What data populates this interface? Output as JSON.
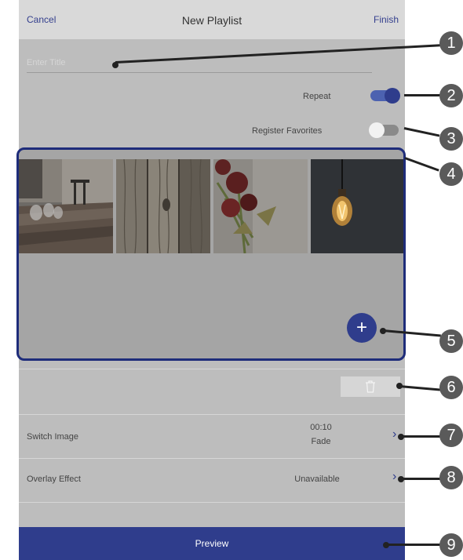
{
  "header": {
    "cancel_label": "Cancel",
    "title": "New Playlist",
    "finish_label": "Finish"
  },
  "title_input": {
    "placeholder": "Enter Title",
    "value": ""
  },
  "settings": {
    "repeat": {
      "label": "Repeat",
      "on": true
    },
    "register_favorites": {
      "label": "Register Favorites",
      "on": false
    }
  },
  "playlist": {
    "thumbnails": [
      {
        "name": "room-photo"
      },
      {
        "name": "wood-photo"
      },
      {
        "name": "dried-roses-photo"
      },
      {
        "name": "lightbulb-photo"
      }
    ],
    "add_icon": "+"
  },
  "rows": {
    "switch_image": {
      "label": "Switch Image",
      "time": "00:10",
      "effect": "Fade"
    },
    "overlay_effect": {
      "label": "Overlay Effect",
      "value": "Unavailable"
    }
  },
  "footer": {
    "preview_label": "Preview"
  },
  "callouts": [
    "1",
    "2",
    "3",
    "4",
    "5",
    "6",
    "7",
    "8",
    "9"
  ],
  "colors": {
    "accent": "#2f3d8c",
    "background": "#bdbdbd",
    "header": "#d9d9d9",
    "callout_badge": "#5a5a5a"
  }
}
